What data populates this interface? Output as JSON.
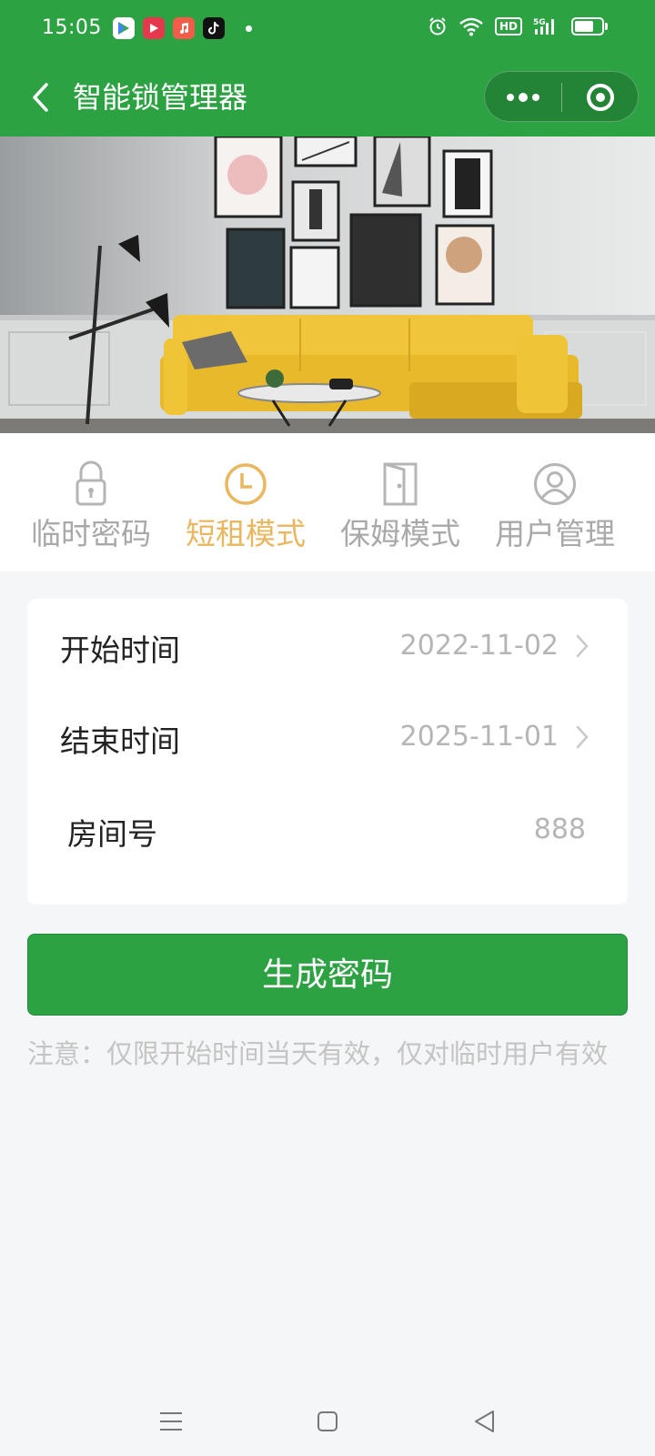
{
  "status_bar": {
    "time": "15:05",
    "apps": [
      "play-store-icon",
      "video-app-icon",
      "music-app-icon",
      "tiktok-icon"
    ],
    "hd_label": "HD",
    "battery_level": 0.75
  },
  "nav_bar": {
    "title": "智能锁管理器",
    "back_icon": "chevron-left-icon",
    "more_icon": "more-dots-icon",
    "close_icon": "target-close-icon",
    "color": "#2ca243"
  },
  "tabs": [
    {
      "label": "临时密码",
      "icon": "lock-icon",
      "active": false
    },
    {
      "label": "短租模式",
      "icon": "clock-icon",
      "active": true
    },
    {
      "label": "保姆模式",
      "icon": "door-icon",
      "active": false
    },
    {
      "label": "用户管理",
      "icon": "user-icon",
      "active": false
    }
  ],
  "form": {
    "start": {
      "label": "开始时间",
      "value": "2022-11-02"
    },
    "end": {
      "label": "结束时间",
      "value": "2025-11-01"
    },
    "room": {
      "label": "房间号",
      "value": "888"
    }
  },
  "generate_button": "生成密码",
  "note": "注意：仅限开始时间当天有效，仅对临时用户有效",
  "colors": {
    "primary": "#2ca243",
    "active_tab": "#e8b760",
    "inactive_tab": "#a9a9a9"
  }
}
